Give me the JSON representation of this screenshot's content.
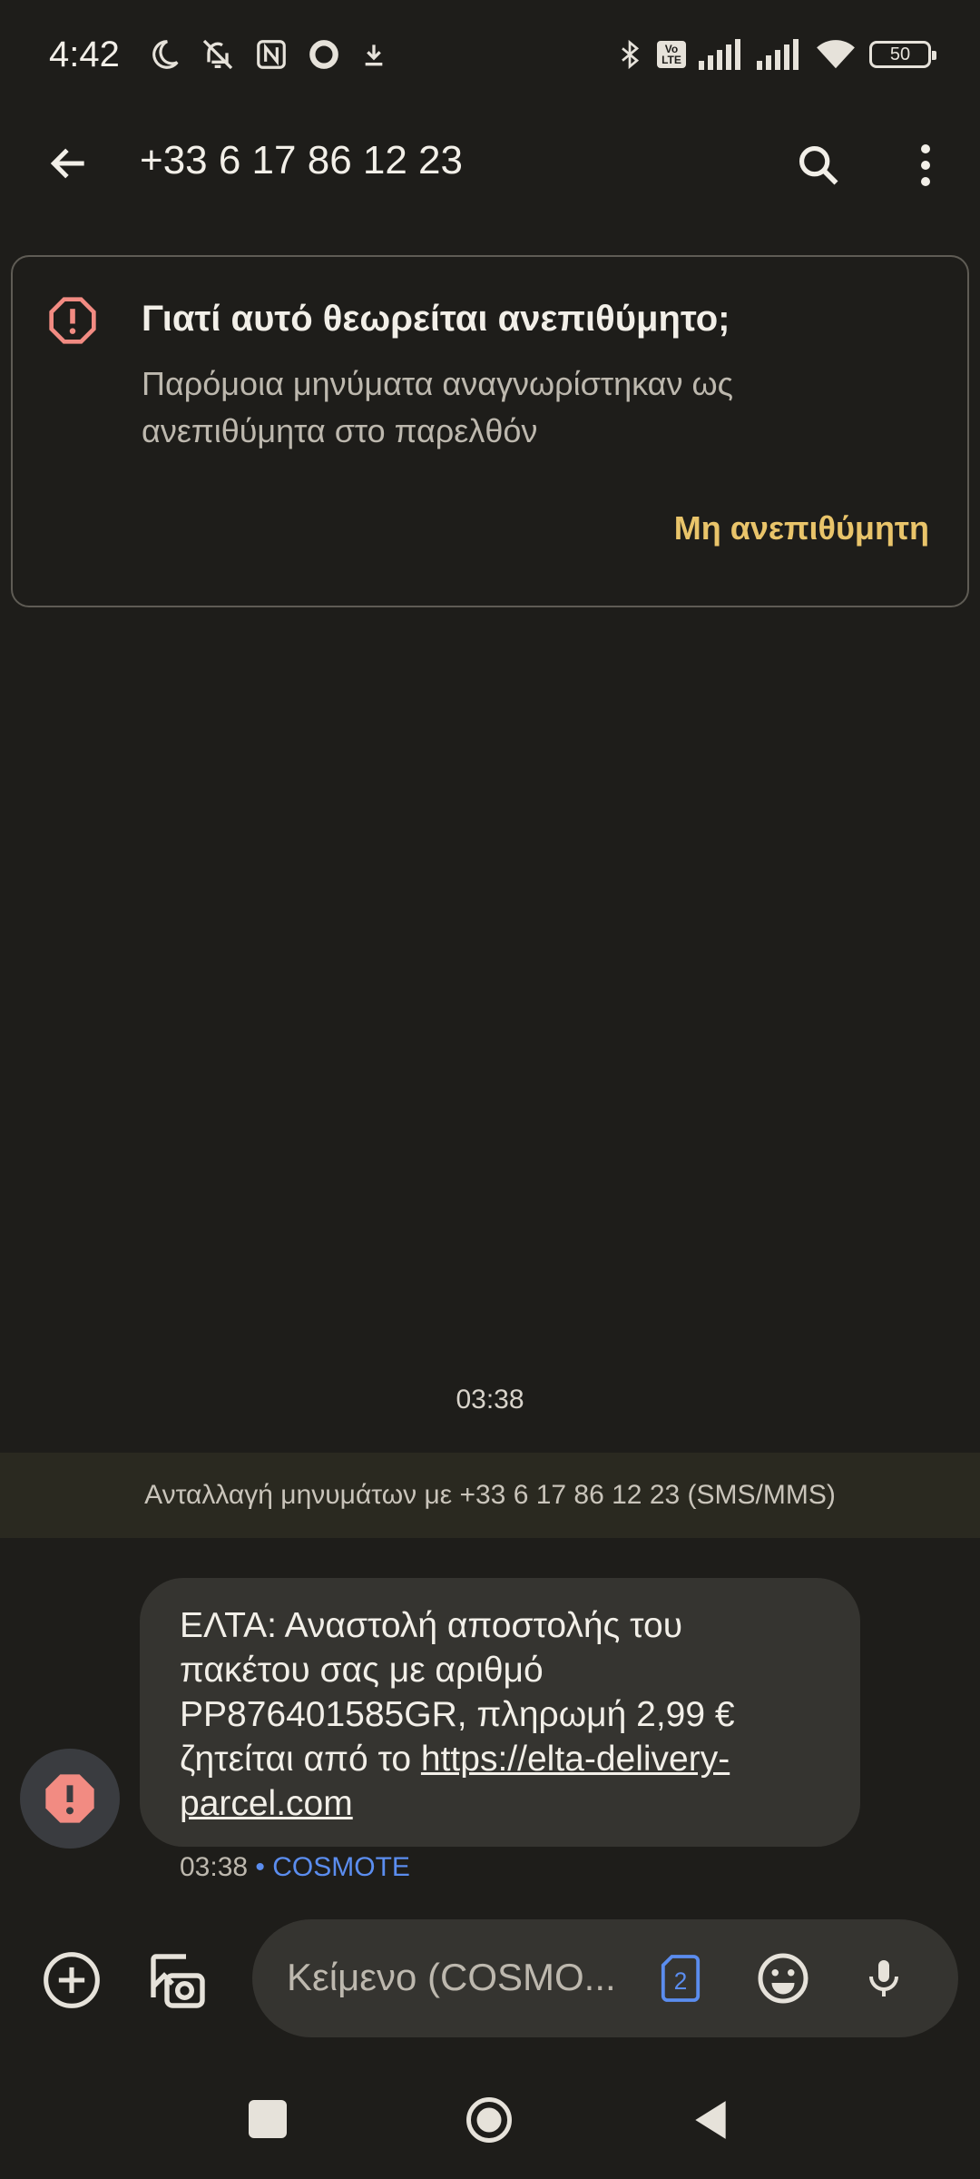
{
  "status_bar": {
    "time": "4:42",
    "volte_top": "Vo",
    "volte_bottom": "LTE",
    "battery": "50"
  },
  "app_bar": {
    "title": "+33 6 17 86 12 23",
    "icons": [
      "back-arrow-icon",
      "search-icon",
      "more-vert-icon"
    ]
  },
  "spam_card": {
    "title": "Γιατί αυτό θεωρείται ανεπιθύμητο;",
    "body": "Παρόμοια μηνύματα αναγνωρίστηκαν ως ανεπιθύμητα στο παρελθόν",
    "action": "Μη ανεπιθύμητη",
    "accent_color": "#e9c46a",
    "warning_color": "#f28b82"
  },
  "conversation": {
    "time_divider": "03:38",
    "banner": "Ανταλλαγή μηνυμάτων με +33 6 17 86 12 23 (SMS/MMS)",
    "message": {
      "text": "ΕΛΤΑ: Αναστολή αποστολής του πακέτου σας με αριθμό PP876401585GR, πληρωμή 2,99 € ζητείται από το ",
      "link": "https://elta-delivery-parcel.com",
      "time": "03:38",
      "separator": " • ",
      "carrier": "COSMOTE"
    }
  },
  "compose": {
    "placeholder": "Κείμενο (COSMO...",
    "sim_number": "2"
  }
}
